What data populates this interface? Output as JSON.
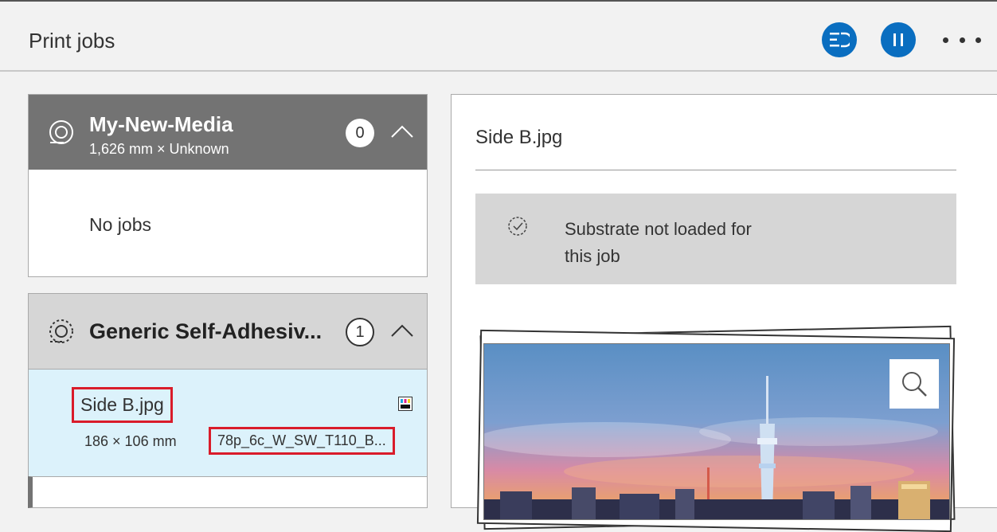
{
  "header": {
    "title": "Print jobs",
    "queue_icon": "queue-settings-icon",
    "pause_icon": "pause-icon",
    "more_icon": "more-options-icon"
  },
  "media_groups": [
    {
      "name": "My-New-Media",
      "subtitle": "1,626 mm × Unknown",
      "count": "0",
      "empty_text": "No jobs"
    },
    {
      "name": "Generic Self-Adhesiv...",
      "count": "1",
      "jobs": [
        {
          "name": "Side B.jpg",
          "size": "186 × 106 mm",
          "profile": "78p_6c_W_SW_T110_B..."
        }
      ]
    }
  ],
  "details": {
    "title": "Side B.jpg",
    "status_line1": "Substrate not loaded for",
    "status_line2": "this job"
  },
  "colors": {
    "accent": "#0a6ec0",
    "highlight_border": "#d91c2a",
    "selected_row": "#dcf2fb",
    "active_group_header": "#737373",
    "inactive_group_header": "#d6d6d6"
  }
}
